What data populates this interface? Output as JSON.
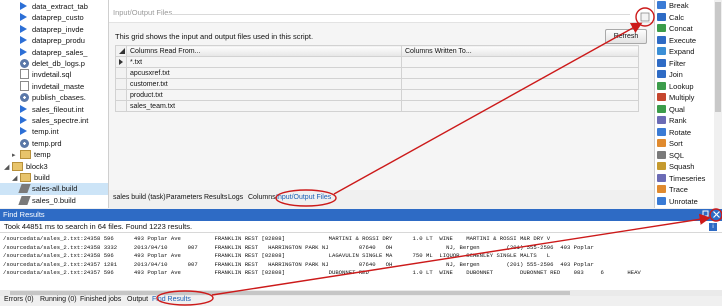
{
  "tree": {
    "items": [
      {
        "label": "data_extract_tab",
        "icon": "play-icon",
        "indent": 2
      },
      {
        "label": "dataprep_custo",
        "icon": "play-icon",
        "indent": 2
      },
      {
        "label": "dataprep_invde",
        "icon": "play-icon",
        "indent": 2
      },
      {
        "label": "dataprep_produ",
        "icon": "play-icon",
        "indent": 2
      },
      {
        "label": "dataprep_sales_",
        "icon": "play-icon",
        "indent": 2
      },
      {
        "label": "delet_db_logs.p",
        "icon": "gear-icon",
        "indent": 2
      },
      {
        "label": "invdetail.sql",
        "icon": "file-icon",
        "indent": 2
      },
      {
        "label": "invdetail_maste",
        "icon": "file-icon",
        "indent": 2
      },
      {
        "label": "publish_cbases.",
        "icon": "gear-icon",
        "indent": 2
      },
      {
        "label": "sales_fileout.int",
        "icon": "play-icon",
        "indent": 2
      },
      {
        "label": "sales_spectre.int",
        "icon": "play-icon",
        "indent": 2
      },
      {
        "label": "temp.int",
        "icon": "play-icon",
        "indent": 2
      },
      {
        "label": "temp.prd",
        "icon": "gear-icon",
        "indent": 2
      },
      {
        "label": "temp",
        "icon": "folder-icon",
        "indent": 1,
        "expander": "▸"
      },
      {
        "label": "block3",
        "icon": "folder-icon",
        "indent": 0,
        "expander": "◢"
      },
      {
        "label": "build",
        "icon": "folder-icon",
        "indent": 1,
        "expander": "◢"
      },
      {
        "label": "sales-all.build",
        "icon": "build-icon",
        "indent": 2,
        "selected": true
      },
      {
        "label": "sales_0.build",
        "icon": "build-icon",
        "indent": 2
      }
    ]
  },
  "io_panel": {
    "header": "Input/Output Files",
    "description": "This grid shows the input and output files used in this script.",
    "refresh_label": "Refresh",
    "columns": [
      "Columns Read From...",
      "Columns Written To..."
    ],
    "rows": [
      "*.txt",
      "apcusxref.txt",
      "customer.txt",
      "product.txt",
      "sales_team.txt"
    ]
  },
  "tabs": [
    {
      "label": "sales build (task)"
    },
    {
      "label": "Parameters"
    },
    {
      "label": "Results"
    },
    {
      "label": "Logs"
    },
    {
      "label": "Columns"
    },
    {
      "label": "Input/Output Files",
      "active": true
    }
  ],
  "palette": {
    "items": [
      {
        "label": "Break",
        "icon": "break-icon",
        "color": "#3a7bd5"
      },
      {
        "label": "Calc",
        "icon": "calc-icon",
        "color": "#2e6bc5"
      },
      {
        "label": "Concat",
        "icon": "concat-icon",
        "color": "#3b9c4a"
      },
      {
        "label": "Execute",
        "icon": "execute-icon",
        "color": "#2e6bc5"
      },
      {
        "label": "Expand",
        "icon": "expand-icon",
        "color": "#3b8fd6"
      },
      {
        "label": "Filter",
        "icon": "filter-icon",
        "color": "#2e6bc5"
      },
      {
        "label": "Join",
        "icon": "join-icon",
        "color": "#2e6bc5"
      },
      {
        "label": "Lookup",
        "icon": "lookup-icon",
        "color": "#3b9c4a"
      },
      {
        "label": "Multiply",
        "icon": "multiply-icon",
        "color": "#c5462e"
      },
      {
        "label": "Qual",
        "icon": "qual-icon",
        "color": "#3b9c4a"
      },
      {
        "label": "Rank",
        "icon": "rank-icon",
        "color": "#6b6bb5"
      },
      {
        "label": "Rotate",
        "icon": "rotate-icon",
        "color": "#3a7bd5"
      },
      {
        "label": "Sort",
        "icon": "sort-icon",
        "color": "#e08a2e"
      },
      {
        "label": "SQL",
        "icon": "sql-icon",
        "color": "#7a7a7a"
      },
      {
        "label": "Squash",
        "icon": "squash-icon",
        "color": "#c59a2e"
      },
      {
        "label": "Timeseries",
        "icon": "timeseries-icon",
        "color": "#6b6bb5"
      },
      {
        "label": "Trace",
        "icon": "trace-icon",
        "color": "#e08a2e"
      },
      {
        "label": "Unrotate",
        "icon": "unrotate-icon",
        "color": "#3a7bd5"
      }
    ]
  },
  "find": {
    "title": "Find Results",
    "summary": "Took 44851 ms to search in 64 files. Found 1223 results.",
    "lines": [
      "/sourcedata/sales_2.txt:24358 596      493 Poplar Ave          FRANKLIN REST [02808]             MARTINI & ROSSI DRY      1.0 LT  WINE    MARTINI & ROSSI M&R DRY V",
      "/sourcedata/sales_2.txt:24358 3332     2013/04/10      007     FRANKLIN REST   HARRINGTON PARK NJ         07640   OH                NJ, Bergen        (201) 555-2596  493 Poplar",
      "/sourcedata/sales_2.txt:24358 596      493 Poplar Ave          FRANKLIN REST [02808]             LAGAVULIN SINGLE MA      750 ML  LIQUOR  SCHENLEY SINGLE MALTS   L",
      "/sourcedata/sales_2.txt:24357 1281     2013/04/10      007     FRANKLIN REST   HARRINGTON PARK NJ         07640   OH                NJ, Bergen        (201) 555-2596  493 Poplar",
      "/sourcedata/sales_2.txt:24357 596      493 Poplar Ave          FRANKLIN REST [02808]             DUBONNET RED             1.0 LT  WINE    DUBONNET        DUBONNET RED    083     6       HEAV"
    ]
  },
  "bottom_tabs": [
    {
      "label": "Errors (0)"
    },
    {
      "label": "Running (0)"
    },
    {
      "label": "Finished jobs"
    },
    {
      "label": "Output"
    },
    {
      "label": "Find Results",
      "active": true
    }
  ],
  "colors": {
    "accent": "#2e6bc5",
    "annotation": "#cc1a1a"
  }
}
